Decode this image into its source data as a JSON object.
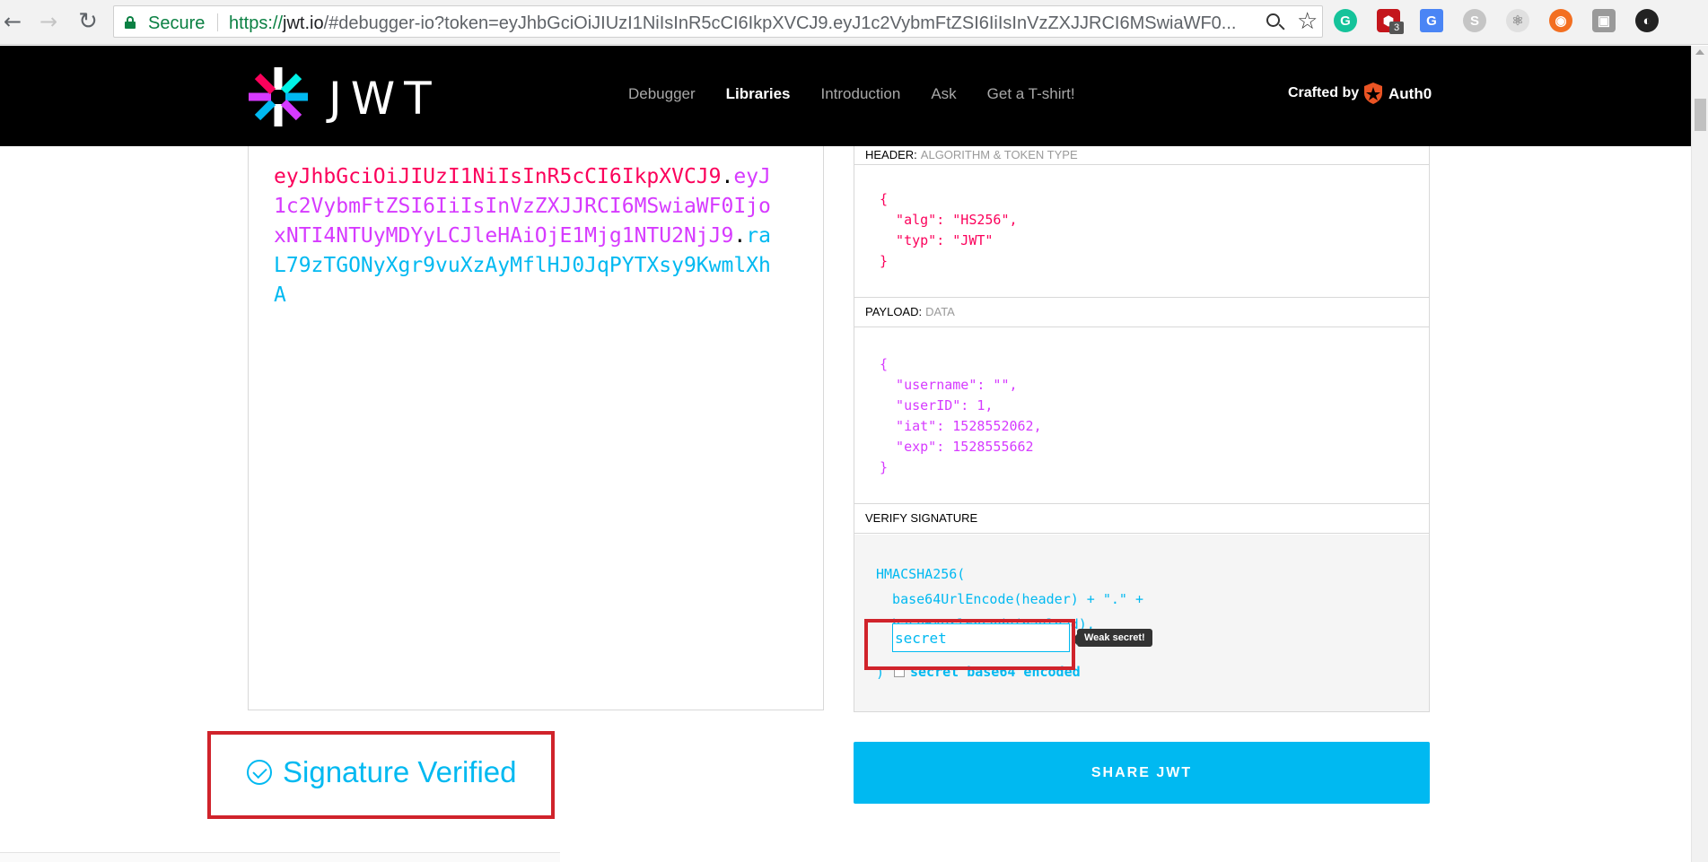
{
  "browser": {
    "secure_label": "Secure",
    "url_scheme": "https://",
    "url_host": "jwt.io",
    "url_rest": "/#debugger-io?token=eyJhbGciOiJIUzI1NiIsInR5cCI6IkpXVCJ9.eyJ1c2VybmFtZSI6IiIsInVzZXJJRCI6MSwiaWF0...",
    "extensions": [
      {
        "icon": "grammarly-icon",
        "glyph": "G",
        "color": "#15c39a"
      },
      {
        "icon": "ublock-icon",
        "glyph": "",
        "color": "#c4161c",
        "badge": "3"
      },
      {
        "icon": "translate-icon",
        "glyph": "G",
        "color": "#4a85f5"
      },
      {
        "icon": "skype-icon",
        "glyph": "S",
        "color": "#c5c5c5"
      },
      {
        "icon": "react-devtools-icon",
        "glyph": "⚛",
        "color": "#d0d0d0"
      },
      {
        "icon": "ubuntu-icon",
        "glyph": "◉",
        "color": "#f36f21"
      },
      {
        "icon": "extension-grey-icon",
        "glyph": "▣",
        "color": "#9a9a9a"
      },
      {
        "icon": "color-picker-icon",
        "glyph": "◐",
        "color": "#222222"
      }
    ]
  },
  "site": {
    "logo_text": "JWT",
    "nav": [
      "Debugger",
      "Libraries",
      "Introduction",
      "Ask",
      "Get a T-shirt!"
    ],
    "active_nav": "Libraries",
    "crafted_by": "Crafted by",
    "brand": "Auth0"
  },
  "encoded": {
    "header": "eyJhbGciOiJIUzI1NiIsInR5cCI6IkpXVCJ9",
    "payload": "eyJ1c2VybmFtZSI6IiIsInVzZXJJRCI6MSwiaWF0IjoxNTI4NTUyMDYyLCJleHAiOjE1Mjg1NTU2NjJ9",
    "signature": "raL79zTGONyXgr9vuXzAyMflHJ0JqPYTXsy9KwmlXhA"
  },
  "decoded": {
    "header_label": "HEADER:",
    "header_sub": "ALGORITHM & TOKEN TYPE",
    "header_code": "{\n  \"alg\": \"HS256\",\n  \"typ\": \"JWT\"\n}",
    "payload_label": "PAYLOAD:",
    "payload_sub": "DATA",
    "payload_code": "{\n  \"username\": \"\",\n  \"userID\": 1,\n  \"iat\": 1528552062,\n  \"exp\": 1528555662\n}",
    "verify_label": "VERIFY SIGNATURE",
    "verify_code": "HMACSHA256(\n  base64UrlEncode(header) + \".\" +\n  base64UrlEncode(payload),",
    "secret_value": "secret",
    "tooltip": "Weak secret!",
    "close_paren": ")",
    "b64_label": "secret base64 encoded",
    "b64_checked": false
  },
  "status": {
    "text": "Signature Verified",
    "color": "#00b9f1"
  },
  "share_button": "SHARE JWT",
  "colors": {
    "header_red": "#fb015b",
    "payload_purple": "#d63aff",
    "signature_blue": "#00b9f1",
    "annotation_red": "#d0232b"
  }
}
